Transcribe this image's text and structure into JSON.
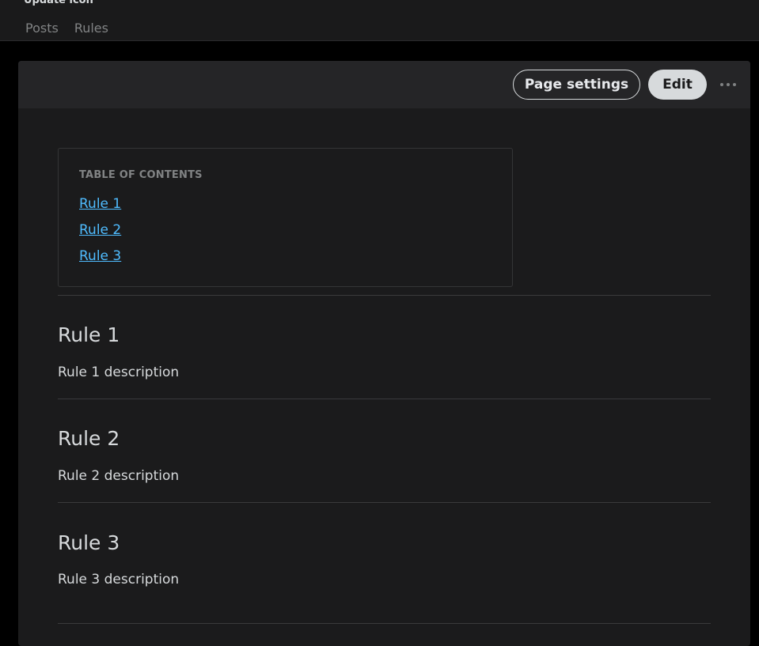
{
  "header": {
    "title_partial": "Update icon",
    "tabs": [
      {
        "label": "Posts"
      },
      {
        "label": "Rules"
      }
    ]
  },
  "toolbar": {
    "page_settings_label": "Page settings",
    "edit_label": "Edit",
    "more_icon": "ellipsis-icon"
  },
  "toc": {
    "title": "TABLE OF CONTENTS",
    "links": [
      {
        "label": "Rule 1"
      },
      {
        "label": "Rule 2"
      },
      {
        "label": "Rule 3"
      }
    ]
  },
  "rules": [
    {
      "title": "Rule 1",
      "description": "Rule 1 description"
    },
    {
      "title": "Rule 2",
      "description": "Rule 2 description"
    },
    {
      "title": "Rule 3",
      "description": "Rule 3 description"
    }
  ],
  "colors": {
    "background": "#000000",
    "card": "#1b1b1c",
    "header_bar": "#252527",
    "link": "#4fbcff",
    "text": "#d7dadc",
    "muted": "#818384"
  }
}
